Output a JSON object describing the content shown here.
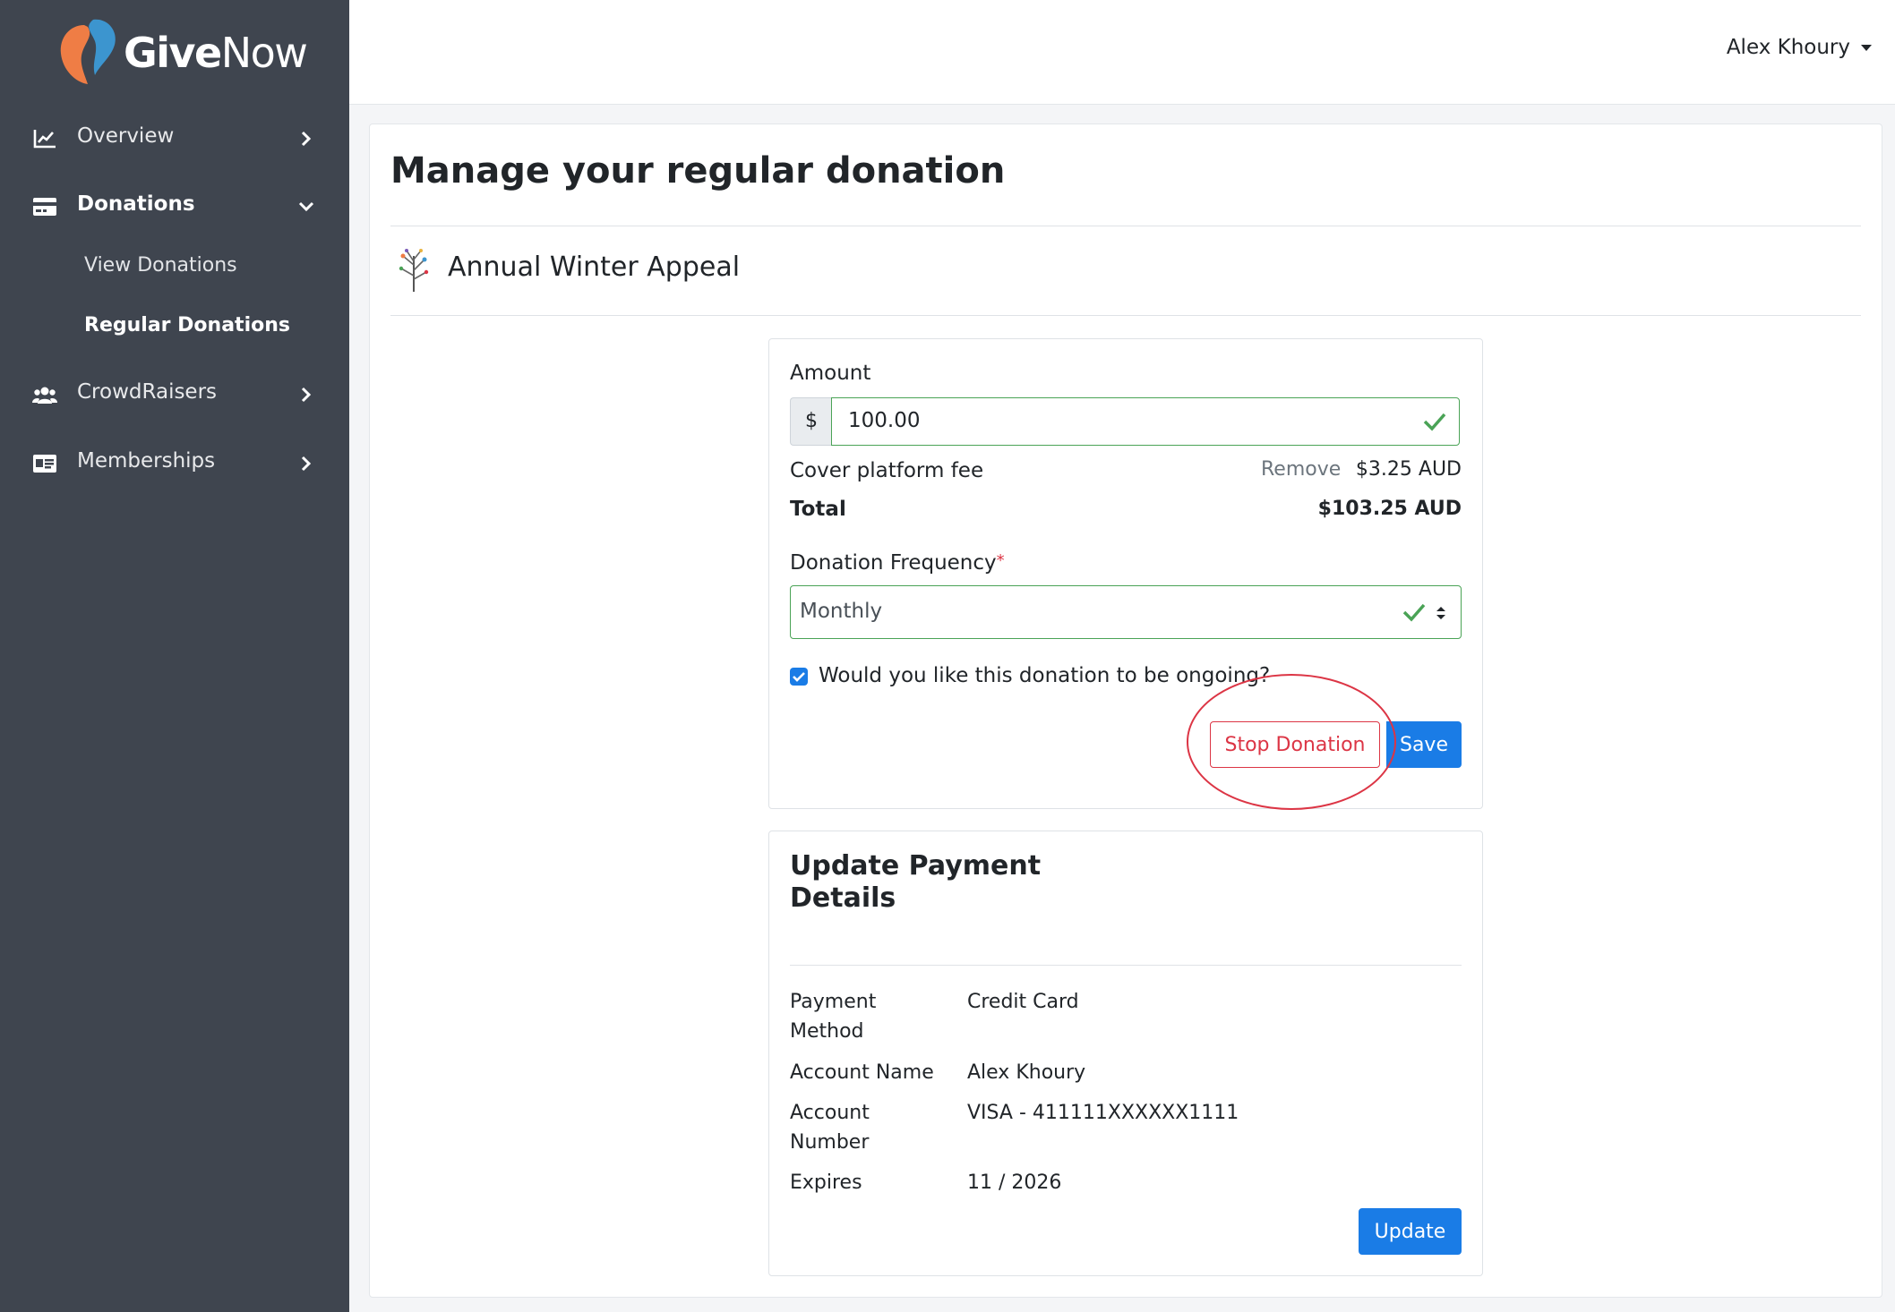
{
  "brand": {
    "logo_give": "Give",
    "logo_now": "Now",
    "accent_orange": "#ef7d45",
    "accent_blue": "#3c95cf"
  },
  "sidebar": {
    "items": [
      {
        "label": "Overview",
        "icon": "chart-line-icon"
      },
      {
        "label": "Donations",
        "icon": "credit-card-icon"
      },
      {
        "label": "CrowdRaisers",
        "icon": "users-icon"
      },
      {
        "label": "Memberships",
        "icon": "id-card-icon"
      }
    ],
    "subitems": [
      {
        "label": "View Donations"
      },
      {
        "label": "Regular Donations"
      }
    ]
  },
  "header": {
    "user_name": "Alex Khoury"
  },
  "page": {
    "title": "Manage your regular donation",
    "campaign_name": "Annual Winter Appeal"
  },
  "donation_form": {
    "amount_label": "Amount",
    "currency_symbol": "$",
    "amount_value": "100.00",
    "fee_label": "Cover platform fee",
    "remove_label": "Remove",
    "fee_value": "$3.25 AUD",
    "total_label": "Total",
    "total_value": "$103.25 AUD",
    "frequency_label": "Donation Frequency",
    "required_marker": "*",
    "frequency_value": "Monthly",
    "ongoing_label": "Would you like this donation to be ongoing?",
    "ongoing_checked": true,
    "stop_label": "Stop Donation",
    "save_label": "Save"
  },
  "payment": {
    "title": "Update Payment Details",
    "rows": [
      {
        "label": "Payment Method",
        "value": "Credit Card"
      },
      {
        "label": "Account Name",
        "value": "Alex Khoury"
      },
      {
        "label": "Account Number",
        "value": "VISA - 411111XXXXXX1111"
      },
      {
        "label": "Expires",
        "value": "11 / 2026"
      }
    ],
    "update_label": "Update"
  },
  "colors": {
    "sidebar_bg": "#3f454f",
    "primary_blue": "#1a7ce6",
    "danger_red": "#dc3545",
    "valid_green": "#4aa356"
  }
}
